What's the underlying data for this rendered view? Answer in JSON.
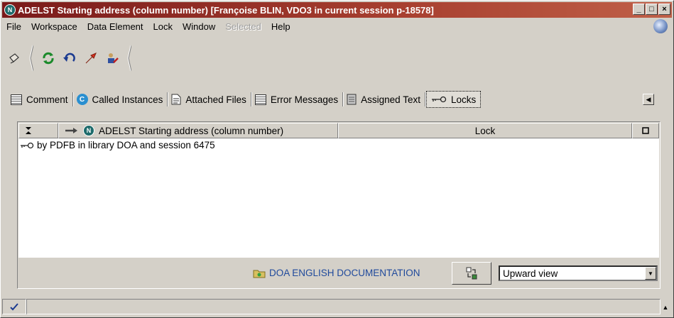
{
  "window": {
    "title": "ADELST Starting address (column number) [Françoise BLIN, VDO3 in current session p-18578]",
    "icon_letter": "N",
    "minimize_label": "_",
    "maximize_label": "□",
    "close_label": "×"
  },
  "menu": {
    "items": [
      "File",
      "Workspace",
      "Data Element",
      "Lock",
      "Window",
      "Selected",
      "Help"
    ],
    "disabled": [
      "Selected"
    ]
  },
  "toolbar": {
    "icons": [
      "pointer-icon",
      "refresh-icon",
      "undo-icon",
      "arrow-icon",
      "user-edit-icon"
    ]
  },
  "tabs": [
    {
      "label": "Comment",
      "icon": "comment-icon"
    },
    {
      "label": "Called Instances",
      "icon": "called-instances-icon"
    },
    {
      "label": "Attached Files",
      "icon": "attached-files-icon"
    },
    {
      "label": "Error Messages",
      "icon": "error-messages-icon"
    },
    {
      "label": "Assigned Text",
      "icon": "assigned-text-icon"
    },
    {
      "label": "Locks",
      "icon": "key-icon",
      "active": true
    }
  ],
  "grid": {
    "columns": [
      {
        "label": ""
      },
      {
        "label": "ADELST Starting address (column number)",
        "icon_letter": "N"
      },
      {
        "label": "Lock"
      },
      {
        "label": ""
      }
    ],
    "rows": [
      {
        "text": "by PDFB in library DOA and session 6475",
        "icon": "key-icon"
      }
    ]
  },
  "footer": {
    "documentation_label": "DOA ENGLISH DOCUMENTATION",
    "view_select_value": "Upward view"
  },
  "colors": {
    "titlebar": "#a84030",
    "face": "#d4d0c8",
    "link": "#204a9c"
  }
}
